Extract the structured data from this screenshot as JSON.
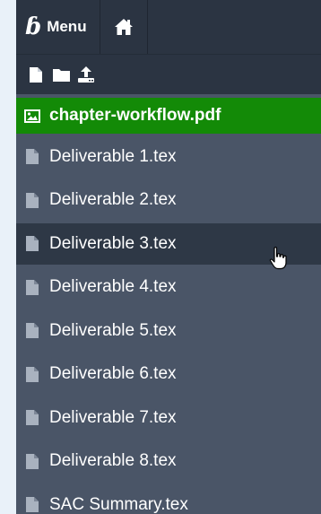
{
  "topbar": {
    "menu_label": "Menu",
    "menu_icon": "overleaf-leaf-icon",
    "home_icon": "home-icon"
  },
  "toolbar": {
    "tools": [
      {
        "icon": "new-file-icon"
      },
      {
        "icon": "new-folder-icon"
      },
      {
        "icon": "upload-icon"
      }
    ]
  },
  "file_tree": {
    "items": [
      {
        "name": "chapter-workflow.pdf",
        "icon": "image-icon",
        "state": "selected"
      },
      {
        "name": "Deliverable 1.tex",
        "icon": "file-icon",
        "state": "normal"
      },
      {
        "name": "Deliverable 2.tex",
        "icon": "file-icon",
        "state": "normal"
      },
      {
        "name": "Deliverable 3.tex",
        "icon": "file-icon",
        "state": "hover"
      },
      {
        "name": "Deliverable 4.tex",
        "icon": "file-icon",
        "state": "normal"
      },
      {
        "name": "Deliverable 5.tex",
        "icon": "file-icon",
        "state": "normal"
      },
      {
        "name": "Deliverable 6.tex",
        "icon": "file-icon",
        "state": "normal"
      },
      {
        "name": "Deliverable 7.tex",
        "icon": "file-icon",
        "state": "normal"
      },
      {
        "name": "Deliverable 8.tex",
        "icon": "file-icon",
        "state": "normal"
      },
      {
        "name": "SAC Summary.tex",
        "icon": "file-icon",
        "state": "normal"
      }
    ]
  },
  "colors": {
    "panel_bg": "#4a5567",
    "topbar_bg": "#2b3442",
    "selected_bg": "#138a07",
    "hover_bg": "#2e3846",
    "page_bg": "#e9f1f9"
  }
}
